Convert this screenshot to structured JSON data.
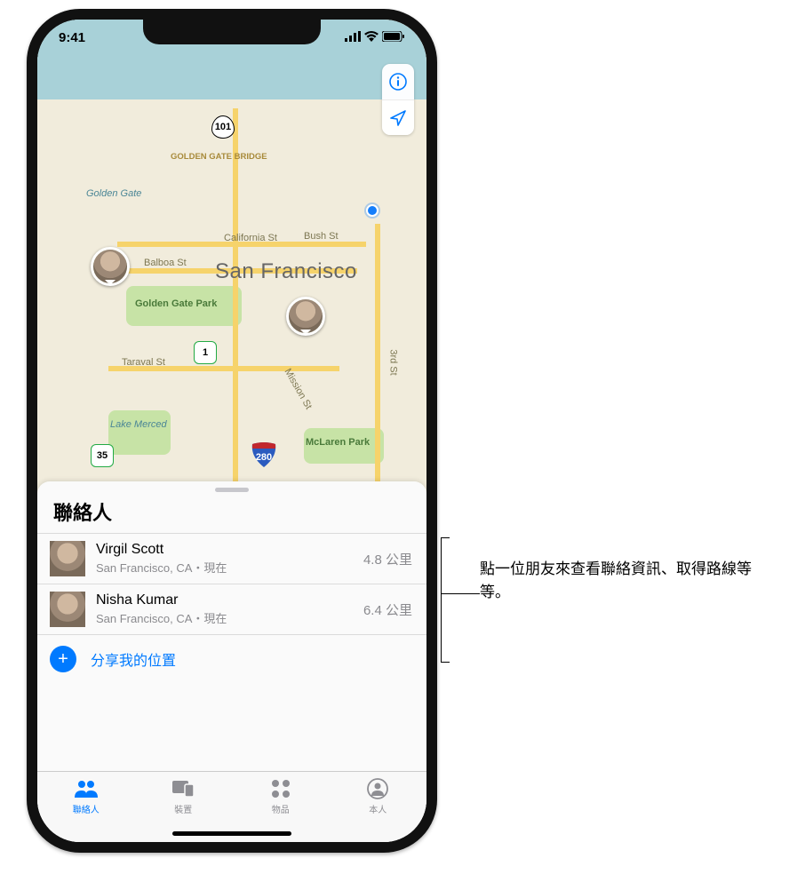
{
  "status": {
    "time": "9:41"
  },
  "map": {
    "city_label": "San Francisco",
    "bridge_label": "GOLDEN GATE BRIDGE",
    "labels": {
      "golden_gate": "Golden Gate",
      "california_st": "California St",
      "bush_st": "Bush St",
      "balboa_st": "Balboa St",
      "ggpark": "Golden Gate Park",
      "taraval": "Taraval St",
      "mission": "Mission St",
      "third": "3rd St",
      "merced": "Lake Merced",
      "mclaren": "McLaren Park"
    },
    "shields": {
      "us101": "101",
      "ca1": "1",
      "ca35": "35",
      "i280": "280"
    }
  },
  "sheet": {
    "title": "聯絡人",
    "contacts": [
      {
        "name": "Virgil Scott",
        "subtitle": "San Francisco, CA・現在",
        "distance": "4.8 公里"
      },
      {
        "name": "Nisha Kumar",
        "subtitle": "San Francisco, CA・現在",
        "distance": "6.4 公里"
      }
    ],
    "share_label": "分享我的位置"
  },
  "tabs": {
    "people": "聯絡人",
    "devices": "裝置",
    "items": "物品",
    "me": "本人"
  },
  "callout": "點一位朋友來查看聯絡資訊、取得路線等等。"
}
